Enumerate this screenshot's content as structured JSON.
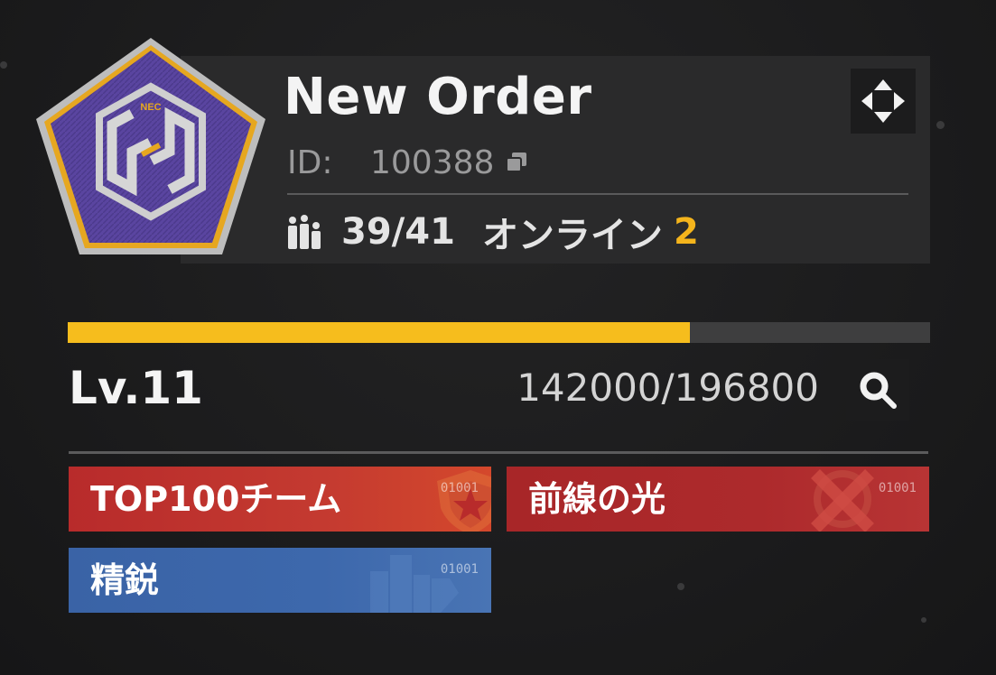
{
  "team": {
    "name": "New Order",
    "emblem_text": "NEC",
    "id_label": "ID:",
    "id_value": "100388"
  },
  "members": {
    "count": "39/41",
    "online_label": "オンライン",
    "online_count": "2"
  },
  "level": {
    "label": "Lv.11",
    "exp_current": 142000,
    "exp_max": 196800,
    "exp_text": "142000/196800",
    "progress": 0.7215
  },
  "tags": [
    {
      "label": "TOP100チーム",
      "code": "01001",
      "color": "#c0332c"
    },
    {
      "label": "前線の光",
      "code": "01001",
      "color": "#ab282b"
    },
    {
      "label": "精鋭",
      "code": "01001",
      "color": "#3b65a9"
    }
  ],
  "icons": {
    "settings": "crosshair-diamond-icon",
    "copy": "copy-icon",
    "members": "members-icon",
    "search": "magnifier-icon"
  },
  "colors": {
    "accent": "#f4b41c",
    "exp_fill": "#f6bd1d"
  }
}
